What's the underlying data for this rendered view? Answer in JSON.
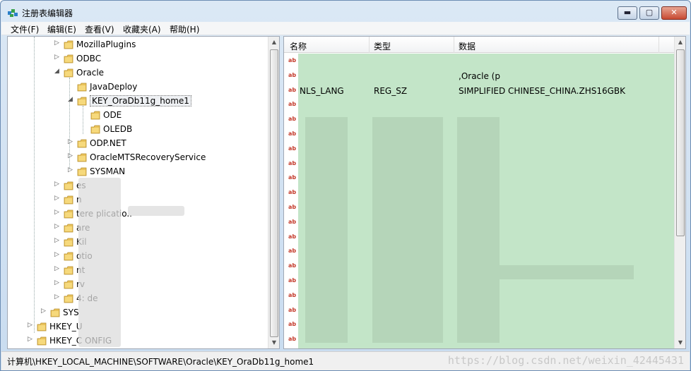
{
  "window": {
    "title": "注册表编辑器"
  },
  "window_controls": {
    "minimize": "▬",
    "maximize": "▢",
    "close": "✕"
  },
  "menu": [
    "文件(F)",
    "编辑(E)",
    "查看(V)",
    "收藏夹(A)",
    "帮助(H)"
  ],
  "tree": [
    {
      "label": "MozillaPlugins",
      "expander": "▷"
    },
    {
      "label": "ODBC",
      "expander": "▷"
    },
    {
      "label": "Oracle",
      "expander": "◢"
    },
    {
      "label": "JavaDeploy",
      "expander": ""
    },
    {
      "label": "KEY_OraDb11g_home1",
      "expander": "◢"
    },
    {
      "label": "ODE",
      "expander": ""
    },
    {
      "label": "OLEDB",
      "expander": ""
    },
    {
      "label": "ODP.NET",
      "expander": "▷"
    },
    {
      "label": "OracleMTSRecoveryService",
      "expander": "▷"
    },
    {
      "label": "SYSMAN",
      "expander": "▷"
    },
    {
      "label": "es",
      "expander": "▷"
    },
    {
      "label": "n",
      "expander": "▷"
    },
    {
      "label": "tere plicatio..",
      "expander": "▷"
    },
    {
      "label": "are",
      "expander": "▷"
    },
    {
      "label": "Kil",
      "expander": "▷"
    },
    {
      "label": "otio",
      "expander": "▷"
    },
    {
      "label": "nt",
      "expander": "▷"
    },
    {
      "label": "rv",
      "expander": "▷"
    },
    {
      "label": "4: de",
      "expander": "▷"
    },
    {
      "label": "SYS",
      "expander": "▷"
    },
    {
      "label": "HKEY_U",
      "expander": "▷"
    },
    {
      "label": "HKEY_C ONFIG",
      "expander": "▷"
    }
  ],
  "list": {
    "columns": [
      "名称",
      "类型",
      "数据"
    ],
    "rows": [
      {
        "name": "",
        "type": "",
        "data": ""
      },
      {
        "name": "",
        "type": "",
        "data": ",Oracle (p"
      },
      {
        "name": "NLS_LANG",
        "type": "REG_SZ",
        "data": "SIMPLIFIED CHINESE_CHINA.ZHS16GBK"
      },
      {
        "name": "",
        "type": "",
        "data": ""
      },
      {
        "name": "",
        "type": "",
        "data": ""
      },
      {
        "name": "",
        "type": "",
        "data": ""
      },
      {
        "name": "",
        "type": "",
        "data": ""
      },
      {
        "name": "",
        "type": "",
        "data": ""
      },
      {
        "name": "",
        "type": "",
        "data": ""
      },
      {
        "name": "",
        "type": "",
        "data": ""
      },
      {
        "name": "",
        "type": "",
        "data": ""
      },
      {
        "name": "",
        "type": "",
        "data": ""
      },
      {
        "name": "",
        "type": "",
        "data": ""
      },
      {
        "name": "",
        "type": "",
        "data": ""
      },
      {
        "name": "",
        "type": "",
        "data": ""
      },
      {
        "name": "",
        "type": "",
        "data": ""
      },
      {
        "name": "",
        "type": "",
        "data": ""
      },
      {
        "name": "",
        "type": "",
        "data": ""
      },
      {
        "name": "",
        "type": "",
        "data": ""
      },
      {
        "name": "",
        "type": "",
        "data": ""
      },
      {
        "name": "",
        "type": "",
        "data": ""
      }
    ],
    "icon_text": "ab"
  },
  "status": {
    "path": "计算机\\HKEY_LOCAL_MACHINE\\SOFTWARE\\Oracle\\KEY_OraDb11g_home1",
    "watermark": "https://blog.csdn.net/weixin_42445431"
  },
  "colors": {
    "redacted_overlay": "#c3e5c8",
    "reg_icon": "#c43a2a"
  }
}
